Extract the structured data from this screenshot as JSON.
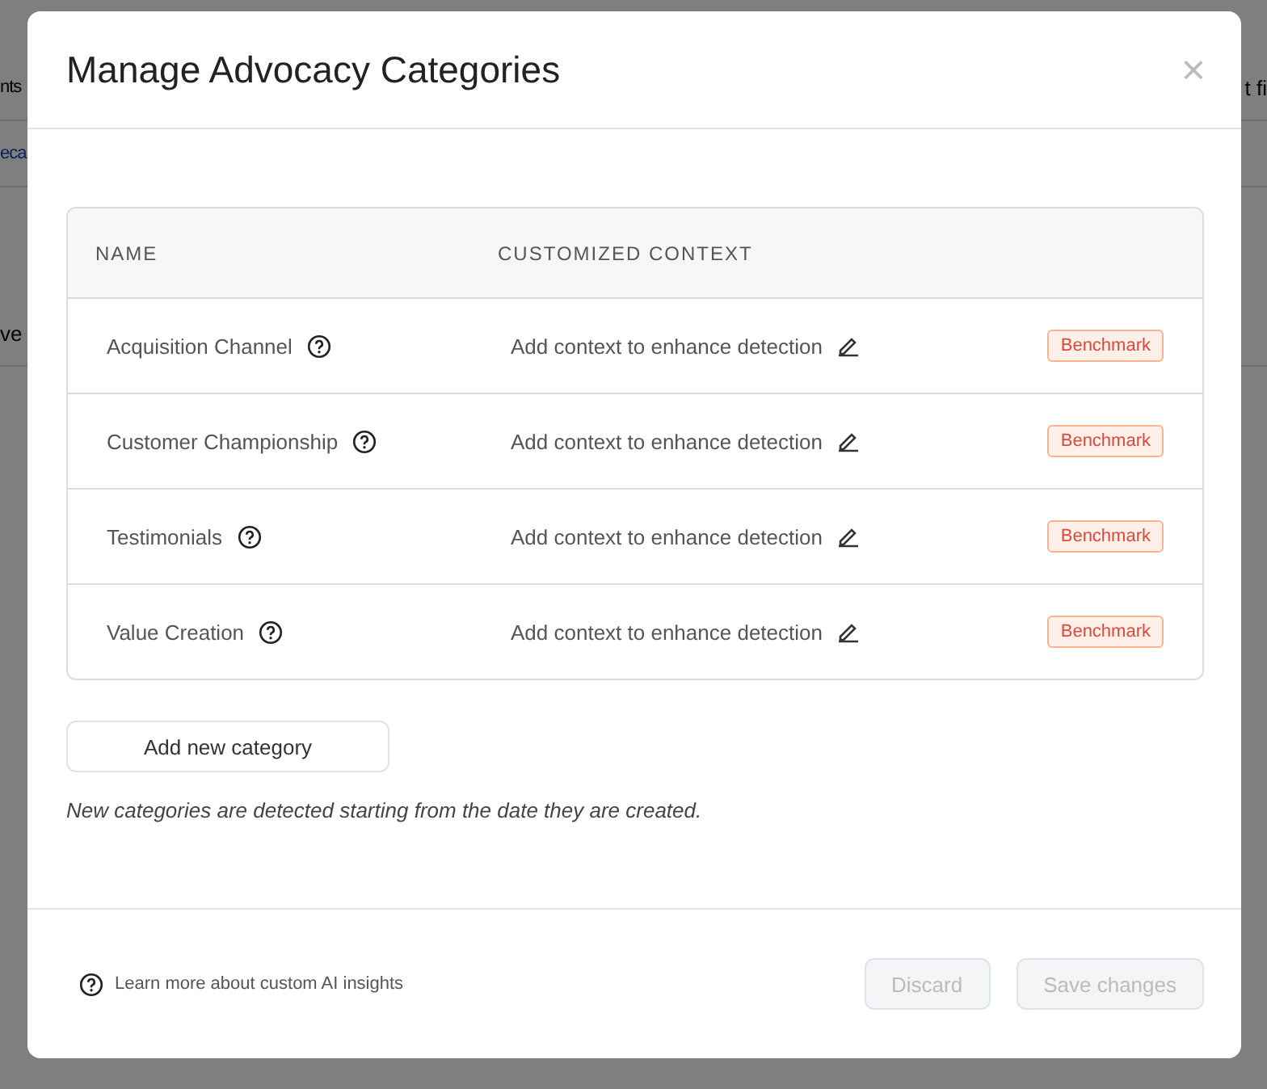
{
  "background": {
    "left_fragments": [
      "nts",
      "eca",
      "ve"
    ],
    "right_fragment": "t fi"
  },
  "dialog": {
    "title": "Manage Advocacy Categories",
    "close": "×",
    "table": {
      "columns": [
        "NAME",
        "CUSTOMIZED CONTEXT"
      ],
      "rows": [
        {
          "name": "Acquisition Channel",
          "context": "Add context to enhance detection",
          "badge": "Benchmark"
        },
        {
          "name": "Customer Championship",
          "context": "Add context to enhance detection",
          "badge": "Benchmark"
        },
        {
          "name": "Testimonials",
          "context": "Add context to enhance detection",
          "badge": "Benchmark"
        },
        {
          "name": "Value Creation",
          "context": "Add context to enhance detection",
          "badge": "Benchmark"
        }
      ]
    },
    "add_button": "Add new category",
    "note": "New categories are detected starting from the date they are created.",
    "footer": {
      "help_link": "Learn more about custom AI insights",
      "buttons": [
        {
          "label": "Discard",
          "disabled": true
        },
        {
          "label": "Save changes",
          "disabled": true
        }
      ]
    }
  }
}
